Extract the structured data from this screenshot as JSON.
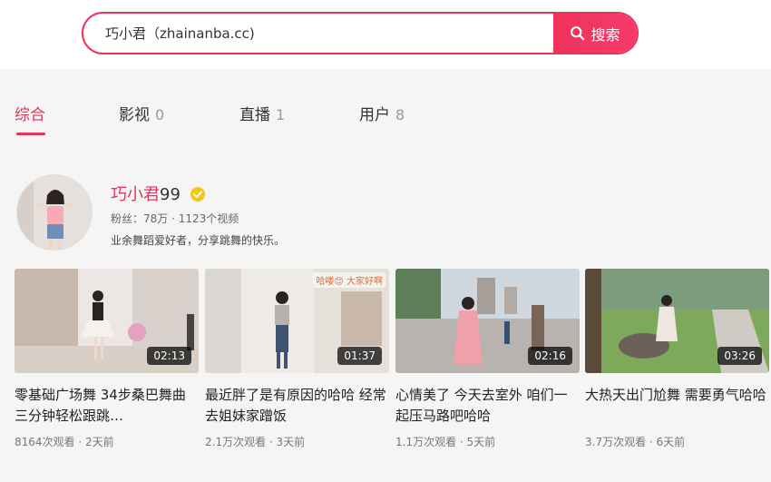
{
  "search": {
    "query": "巧小君（zhainanba.cc)",
    "button_label": "搜索"
  },
  "tabs": [
    {
      "label": "综合",
      "count": ""
    },
    {
      "label": "影视",
      "count": "0"
    },
    {
      "label": "直播",
      "count": "1"
    },
    {
      "label": "用户",
      "count": "8"
    }
  ],
  "user": {
    "name_main": "巧小君",
    "name_suffix": "99",
    "stats": "粉丝：78万 · 1123个视频",
    "bio": "业余舞蹈爱好者，分享跳舞的快乐。"
  },
  "videos": [
    {
      "title": "零基础广场舞 34步桑巴舞曲 三分钟轻松跟跳…",
      "duration": "02:13",
      "meta": "8164次观看 · 2天前"
    },
    {
      "title": "最近胖了是有原因的哈哈 经常去姐妹家蹭饭",
      "duration": "01:37",
      "meta": "2.1万次观看 · 3天前",
      "overlay_text": "哈喽😊 大家好啊"
    },
    {
      "title": "心情美了 今天去室外 咱们一起压马路吧哈哈",
      "duration": "02:16",
      "meta": "1.1万次观看 · 5天前"
    },
    {
      "title": "大热天出门尬舞 需要勇气哈哈",
      "duration": "03:26",
      "meta": "3.7万次观看 · 6天前"
    }
  ],
  "colors": {
    "accent": "#e8335a",
    "verified": "#f5c518"
  }
}
